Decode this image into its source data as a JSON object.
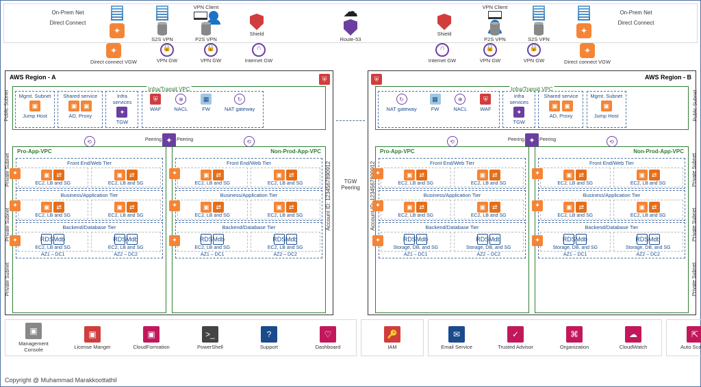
{
  "cloud_glyph": "☁",
  "top": {
    "onprem": "On-Prem Net",
    "directconnect": "Direct Connect",
    "s2s": "S2S VPN",
    "vpnclient": "VPN Client",
    "p2s": "P2S VPN",
    "shield": "Shield",
    "route53": "Route-53"
  },
  "gw": {
    "dcvgw": "Direct connect VGW",
    "vpngw": "VPN GW",
    "igw": "Internet GW"
  },
  "region": {
    "a": "AWS Region - A",
    "b": "AWS Region - B",
    "account": "Account ID: 1234567890912"
  },
  "side": {
    "public": "Public Subnet",
    "private": "Private Subnet"
  },
  "infra": {
    "title": "Infra/Transit VPC",
    "mgmt": "Mgmt. Subnet",
    "jump": "Jump Host",
    "shared": "Shared service",
    "adproxy": "AD, Proxy",
    "infrasrv": "Infra services",
    "tgw": "TGW",
    "waf": "WAF",
    "nacl": "NACL",
    "fw": "FW",
    "nat": "NAT gateway"
  },
  "peering": "Peering",
  "tgw_peering": "TGW\nPeering",
  "vpc": {
    "pro": "Pro-App-VPC",
    "nonpro": "Non-Prod-App-VPC"
  },
  "tier": {
    "front": "Front End/Web Tier",
    "biz": "Business/Application Tier",
    "back": "Backend/Database Tier"
  },
  "az": {
    "ec2": "EC2, LB and SG",
    "storage": "Storage, DB, and SG",
    "az1": "AZ1 – DC1",
    "az2": "AZ2 – DC2"
  },
  "svc": {
    "mc": "Management Console",
    "lm": "License Manger",
    "cf": "CloudFormation",
    "ps": "PowerShell",
    "sup": "Support",
    "dash": "Dashboard",
    "iam": "IAM",
    "email": "Email Service",
    "ta": "Trusted Advisor",
    "org": "Organization",
    "cw": "CloudWatch",
    "as": "Auto Scaling"
  },
  "copyright": "Copyright @ Muhammad  Marakkoottathil"
}
